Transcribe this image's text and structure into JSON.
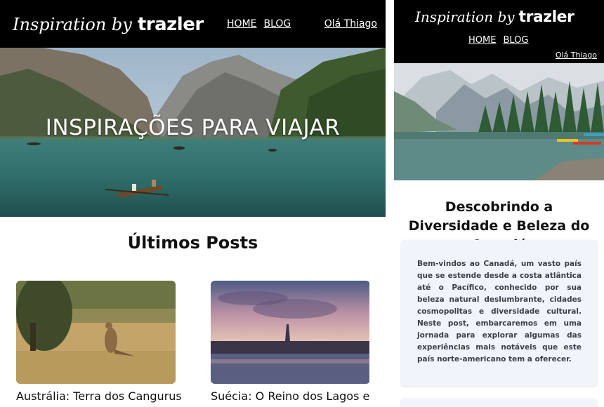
{
  "desktop": {
    "brand": {
      "script": "Inspiration by",
      "logo": "trazler"
    },
    "nav": {
      "home": "HOME",
      "blog": "BLOG"
    },
    "user": "Olá Thiago",
    "hero_title": "INSPIRAÇÕES PARA VIAJAR",
    "section_title": "Últimos Posts",
    "posts": [
      {
        "title": "Austrália: Terra dos Cangurus"
      },
      {
        "title": "Suécia: O Reino dos Lagos e"
      }
    ]
  },
  "mobile": {
    "brand": {
      "script": "Inspiration by",
      "logo": "trazler"
    },
    "nav": {
      "home": "HOME",
      "blog": "BLOG"
    },
    "user": "Olá Thiago",
    "post_title": "Descobrindo a Diversidade e Beleza do Canadá",
    "post_body": "Bem-vindos ao Canadá, um vasto país que se estende desde a costa atlântica até o Pacífico, conhecido por sua beleza natural deslumbrante, cidades cosmopolitas e diversidade cultural. Neste post, embarcaremos em uma jornada para explorar algumas das experiências mais notáveis que este país norte-americano tem a oferecer."
  },
  "icons": [
    "hero-lake-image",
    "kangaroo-image",
    "stockholm-image",
    "canada-lake-image"
  ]
}
